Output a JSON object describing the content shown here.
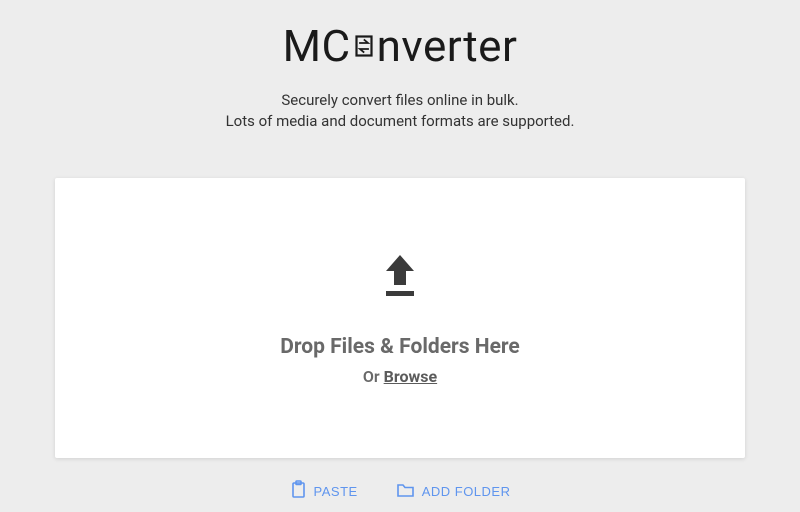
{
  "logo": {
    "prefix": "MC",
    "suffix": "nverter"
  },
  "subtitle": {
    "line1": "Securely convert files online in bulk.",
    "line2": "Lots of media and document formats are supported."
  },
  "dropzone": {
    "heading": "Drop Files & Folders Here",
    "or_prefix": "Or ",
    "browse": "Browse"
  },
  "actions": {
    "paste": "PASTE",
    "add_folder": "ADD FOLDER"
  }
}
